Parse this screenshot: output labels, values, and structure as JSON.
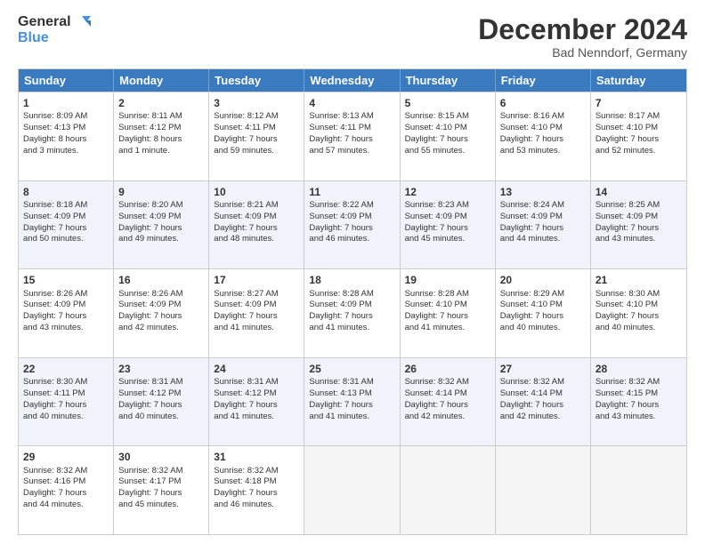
{
  "logo": {
    "line1": "General",
    "line2": "Blue"
  },
  "title": "December 2024",
  "subtitle": "Bad Nenndorf, Germany",
  "header_days": [
    "Sunday",
    "Monday",
    "Tuesday",
    "Wednesday",
    "Thursday",
    "Friday",
    "Saturday"
  ],
  "rows": [
    [
      {
        "day": "1",
        "lines": [
          "Sunrise: 8:09 AM",
          "Sunset: 4:13 PM",
          "Daylight: 8 hours",
          "and 3 minutes."
        ]
      },
      {
        "day": "2",
        "lines": [
          "Sunrise: 8:11 AM",
          "Sunset: 4:12 PM",
          "Daylight: 8 hours",
          "and 1 minute."
        ]
      },
      {
        "day": "3",
        "lines": [
          "Sunrise: 8:12 AM",
          "Sunset: 4:11 PM",
          "Daylight: 7 hours",
          "and 59 minutes."
        ]
      },
      {
        "day": "4",
        "lines": [
          "Sunrise: 8:13 AM",
          "Sunset: 4:11 PM",
          "Daylight: 7 hours",
          "and 57 minutes."
        ]
      },
      {
        "day": "5",
        "lines": [
          "Sunrise: 8:15 AM",
          "Sunset: 4:10 PM",
          "Daylight: 7 hours",
          "and 55 minutes."
        ]
      },
      {
        "day": "6",
        "lines": [
          "Sunrise: 8:16 AM",
          "Sunset: 4:10 PM",
          "Daylight: 7 hours",
          "and 53 minutes."
        ]
      },
      {
        "day": "7",
        "lines": [
          "Sunrise: 8:17 AM",
          "Sunset: 4:10 PM",
          "Daylight: 7 hours",
          "and 52 minutes."
        ]
      }
    ],
    [
      {
        "day": "8",
        "lines": [
          "Sunrise: 8:18 AM",
          "Sunset: 4:09 PM",
          "Daylight: 7 hours",
          "and 50 minutes."
        ]
      },
      {
        "day": "9",
        "lines": [
          "Sunrise: 8:20 AM",
          "Sunset: 4:09 PM",
          "Daylight: 7 hours",
          "and 49 minutes."
        ]
      },
      {
        "day": "10",
        "lines": [
          "Sunrise: 8:21 AM",
          "Sunset: 4:09 PM",
          "Daylight: 7 hours",
          "and 48 minutes."
        ]
      },
      {
        "day": "11",
        "lines": [
          "Sunrise: 8:22 AM",
          "Sunset: 4:09 PM",
          "Daylight: 7 hours",
          "and 46 minutes."
        ]
      },
      {
        "day": "12",
        "lines": [
          "Sunrise: 8:23 AM",
          "Sunset: 4:09 PM",
          "Daylight: 7 hours",
          "and 45 minutes."
        ]
      },
      {
        "day": "13",
        "lines": [
          "Sunrise: 8:24 AM",
          "Sunset: 4:09 PM",
          "Daylight: 7 hours",
          "and 44 minutes."
        ]
      },
      {
        "day": "14",
        "lines": [
          "Sunrise: 8:25 AM",
          "Sunset: 4:09 PM",
          "Daylight: 7 hours",
          "and 43 minutes."
        ]
      }
    ],
    [
      {
        "day": "15",
        "lines": [
          "Sunrise: 8:26 AM",
          "Sunset: 4:09 PM",
          "Daylight: 7 hours",
          "and 43 minutes."
        ]
      },
      {
        "day": "16",
        "lines": [
          "Sunrise: 8:26 AM",
          "Sunset: 4:09 PM",
          "Daylight: 7 hours",
          "and 42 minutes."
        ]
      },
      {
        "day": "17",
        "lines": [
          "Sunrise: 8:27 AM",
          "Sunset: 4:09 PM",
          "Daylight: 7 hours",
          "and 41 minutes."
        ]
      },
      {
        "day": "18",
        "lines": [
          "Sunrise: 8:28 AM",
          "Sunset: 4:09 PM",
          "Daylight: 7 hours",
          "and 41 minutes."
        ]
      },
      {
        "day": "19",
        "lines": [
          "Sunrise: 8:28 AM",
          "Sunset: 4:10 PM",
          "Daylight: 7 hours",
          "and 41 minutes."
        ]
      },
      {
        "day": "20",
        "lines": [
          "Sunrise: 8:29 AM",
          "Sunset: 4:10 PM",
          "Daylight: 7 hours",
          "and 40 minutes."
        ]
      },
      {
        "day": "21",
        "lines": [
          "Sunrise: 8:30 AM",
          "Sunset: 4:10 PM",
          "Daylight: 7 hours",
          "and 40 minutes."
        ]
      }
    ],
    [
      {
        "day": "22",
        "lines": [
          "Sunrise: 8:30 AM",
          "Sunset: 4:11 PM",
          "Daylight: 7 hours",
          "and 40 minutes."
        ]
      },
      {
        "day": "23",
        "lines": [
          "Sunrise: 8:31 AM",
          "Sunset: 4:12 PM",
          "Daylight: 7 hours",
          "and 40 minutes."
        ]
      },
      {
        "day": "24",
        "lines": [
          "Sunrise: 8:31 AM",
          "Sunset: 4:12 PM",
          "Daylight: 7 hours",
          "and 41 minutes."
        ]
      },
      {
        "day": "25",
        "lines": [
          "Sunrise: 8:31 AM",
          "Sunset: 4:13 PM",
          "Daylight: 7 hours",
          "and 41 minutes."
        ]
      },
      {
        "day": "26",
        "lines": [
          "Sunrise: 8:32 AM",
          "Sunset: 4:14 PM",
          "Daylight: 7 hours",
          "and 42 minutes."
        ]
      },
      {
        "day": "27",
        "lines": [
          "Sunrise: 8:32 AM",
          "Sunset: 4:14 PM",
          "Daylight: 7 hours",
          "and 42 minutes."
        ]
      },
      {
        "day": "28",
        "lines": [
          "Sunrise: 8:32 AM",
          "Sunset: 4:15 PM",
          "Daylight: 7 hours",
          "and 43 minutes."
        ]
      }
    ],
    [
      {
        "day": "29",
        "lines": [
          "Sunrise: 8:32 AM",
          "Sunset: 4:16 PM",
          "Daylight: 7 hours",
          "and 44 minutes."
        ]
      },
      {
        "day": "30",
        "lines": [
          "Sunrise: 8:32 AM",
          "Sunset: 4:17 PM",
          "Daylight: 7 hours",
          "and 45 minutes."
        ]
      },
      {
        "day": "31",
        "lines": [
          "Sunrise: 8:32 AM",
          "Sunset: 4:18 PM",
          "Daylight: 7 hours",
          "and 46 minutes."
        ]
      },
      null,
      null,
      null,
      null
    ]
  ]
}
